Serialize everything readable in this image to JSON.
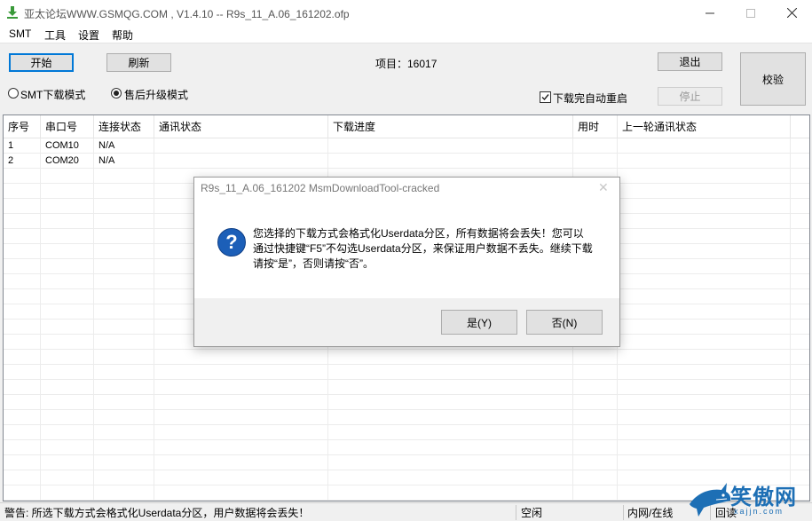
{
  "window": {
    "title": "亚太论坛WWW.GSMQG.COM    , V1.4.10 -- R9s_11_A.06_161202.ofp",
    "min_icon": "minimize-icon",
    "max_icon": "maximize-icon",
    "close_icon": "close-icon"
  },
  "menu": [
    "SMT",
    "工具",
    "设置",
    "帮助"
  ],
  "toolbar": {
    "start_label": "开始",
    "refresh_label": "刷新",
    "project_label": "项目：16017",
    "exit_label": "退出",
    "stop_label": "停止",
    "verify_label": "校验",
    "radio_smt_label": "SMT下载模式",
    "radio_aftersales_label": "售后升级模式",
    "auto_reboot_label": "下载完自动重启"
  },
  "table": {
    "headers": [
      "序号",
      "串口号",
      "连接状态",
      "通讯状态",
      "下载进度",
      "用时",
      "上一轮通讯状态"
    ],
    "rows": [
      [
        "1",
        "COM10",
        "N/A",
        "",
        "",
        "",
        ""
      ],
      [
        "2",
        "COM20",
        "N/A",
        "",
        "",
        "",
        ""
      ]
    ]
  },
  "dialog": {
    "title": "R9s_11_A.06_161202 MsmDownloadTool-cracked",
    "icon": "question-icon",
    "icon_glyph": "?",
    "message": "您选择的下载方式会格式化Userdata分区，所有数据将会丢失！您可以通过快捷键“F5”不勾选Userdata分区，来保证用户数据不丢失。继续下载请按“是”，否则请按“否”。",
    "yes_label": "是(Y)",
    "no_label": "否(N)"
  },
  "status": {
    "warning": "警告: 所选下载方式会格式化Userdata分区，用户数据将会丢失！",
    "idle": "空闲",
    "network": "内网/在线",
    "readback": "回读"
  },
  "watermark": {
    "text": "笑傲网",
    "sub": "xajjn.com"
  },
  "colors": {
    "accent": "#0078d7",
    "dialog_icon": "#1c5fb8",
    "watermark": "#1d6fb5"
  }
}
